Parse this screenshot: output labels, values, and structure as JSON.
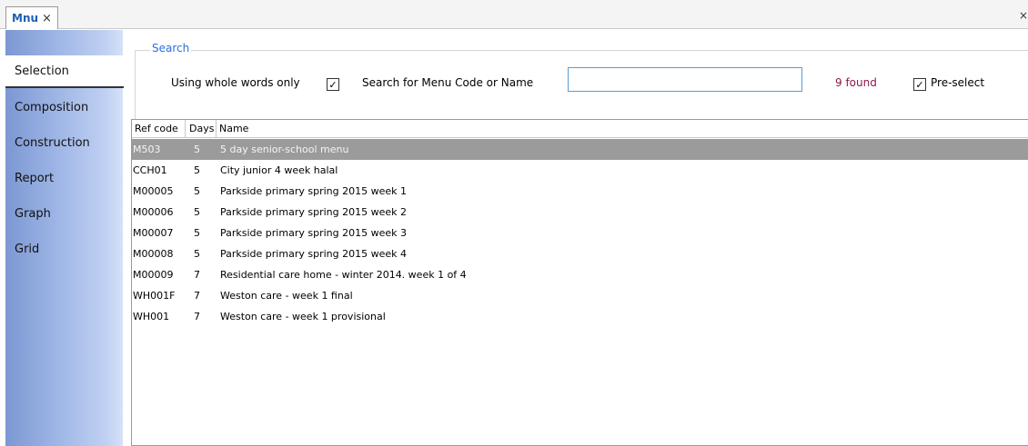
{
  "tabs": [
    {
      "label": "Mnu",
      "close": "×"
    }
  ],
  "window_close": "×",
  "sidebar": {
    "items": [
      {
        "label": "Selection",
        "active": true
      },
      {
        "label": "Composition"
      },
      {
        "label": "Construction"
      },
      {
        "label": "Report"
      },
      {
        "label": "Graph"
      },
      {
        "label": "Grid"
      }
    ]
  },
  "search": {
    "legend": "Search",
    "whole_words_label": "Using whole words only",
    "whole_words_checked": true,
    "field_label": "Search for Menu Code or Name",
    "value": "",
    "found_text": "9 found",
    "preselect_label": "Pre-select",
    "preselect_checked": true,
    "check_mark": "✓"
  },
  "table": {
    "columns": [
      "Ref code",
      "Days",
      "Name"
    ],
    "rows": [
      {
        "ref": "M503",
        "days": "5",
        "name": "5 day senior-school menu",
        "selected": true
      },
      {
        "ref": "CCH01",
        "days": "5",
        "name": "City junior 4 week halal"
      },
      {
        "ref": "M00005",
        "days": "5",
        "name": "Parkside primary spring 2015 week 1"
      },
      {
        "ref": "M00006",
        "days": "5",
        "name": "Parkside primary spring 2015 week 2"
      },
      {
        "ref": "M00007",
        "days": "5",
        "name": "Parkside primary spring 2015 week 3"
      },
      {
        "ref": "M00008",
        "days": "5",
        "name": "Parkside primary spring 2015 week 4"
      },
      {
        "ref": "M00009",
        "days": "7",
        "name": "Residential care home - winter 2014. week 1 of 4"
      },
      {
        "ref": "WH001F",
        "days": "7",
        "name": "Weston care - week 1 final"
      },
      {
        "ref": "WH001",
        "days": "7",
        "name": "Weston care - week 1 provisional"
      }
    ]
  },
  "colors": {
    "accent": "#2a6fdb",
    "found": "#8b1a4a",
    "selected_row": "#9b9b9b"
  }
}
